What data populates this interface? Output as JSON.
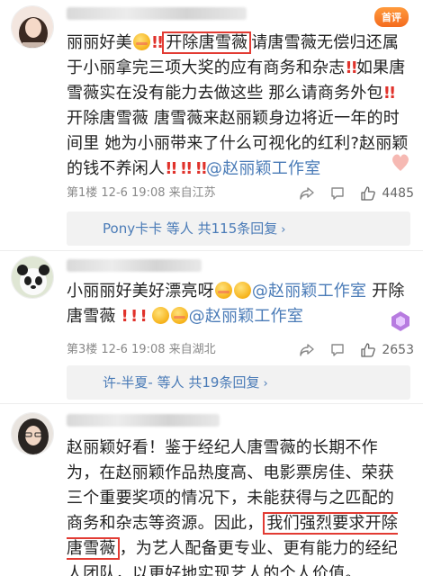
{
  "comments": [
    {
      "follow_badge": "首评",
      "text_parts": {
        "p1": "丽丽好美",
        "boxed": "开除唐雪薇",
        "p2": "请唐雪薇无偿归还属于小丽拿完三项大奖的应有商务和杂志",
        "p3": "如果唐雪薇实在没有能力去做这些 那么请商务外包",
        "p4": "开除唐雪薇 唐雪薇来赵丽颖身边将近一年的时间里 她为小丽带来了什么可视化的红利?赵丽颖的钱不养闲人",
        "mention": "@赵丽颖工作室"
      },
      "meta": "第1楼 12-6 19:08 来自江苏",
      "likes": "4485",
      "replies": "Pony卡卡 等人 共115条回复"
    },
    {
      "text_parts": {
        "p1": "小丽丽好美好漂亮呀",
        "mention1": "@赵丽颖工作室",
        "p2": "开除唐雪薇",
        "mention2": "@赵丽颖工作室"
      },
      "meta": "第3楼 12-6 19:08 来自湖北",
      "likes": "2653",
      "replies": "许-半夏- 等人 共19条回复"
    },
    {
      "text_parts": {
        "p1": "赵丽颖好看！鉴于经纪人唐雪薇的长期不作为，在赵丽颖作品热度高、电影票房佳、荣获三个重要奖项的情况下，未能获得与之匹配的商务和杂志等资源。因此，",
        "boxed": "我们强烈要求开除唐雪薇",
        "p2": "，为艺人配备更专业、更有能力的经纪人团队，以更好地实现艺人的个人价值。"
      }
    }
  ],
  "icons": {
    "share": "share-icon",
    "comment": "comment-icon",
    "like": "thumbs-up-icon"
  },
  "colors": {
    "mention": "#4a7bb7",
    "highlight_box": "#e23b33",
    "exclamation": "#e0322b"
  }
}
